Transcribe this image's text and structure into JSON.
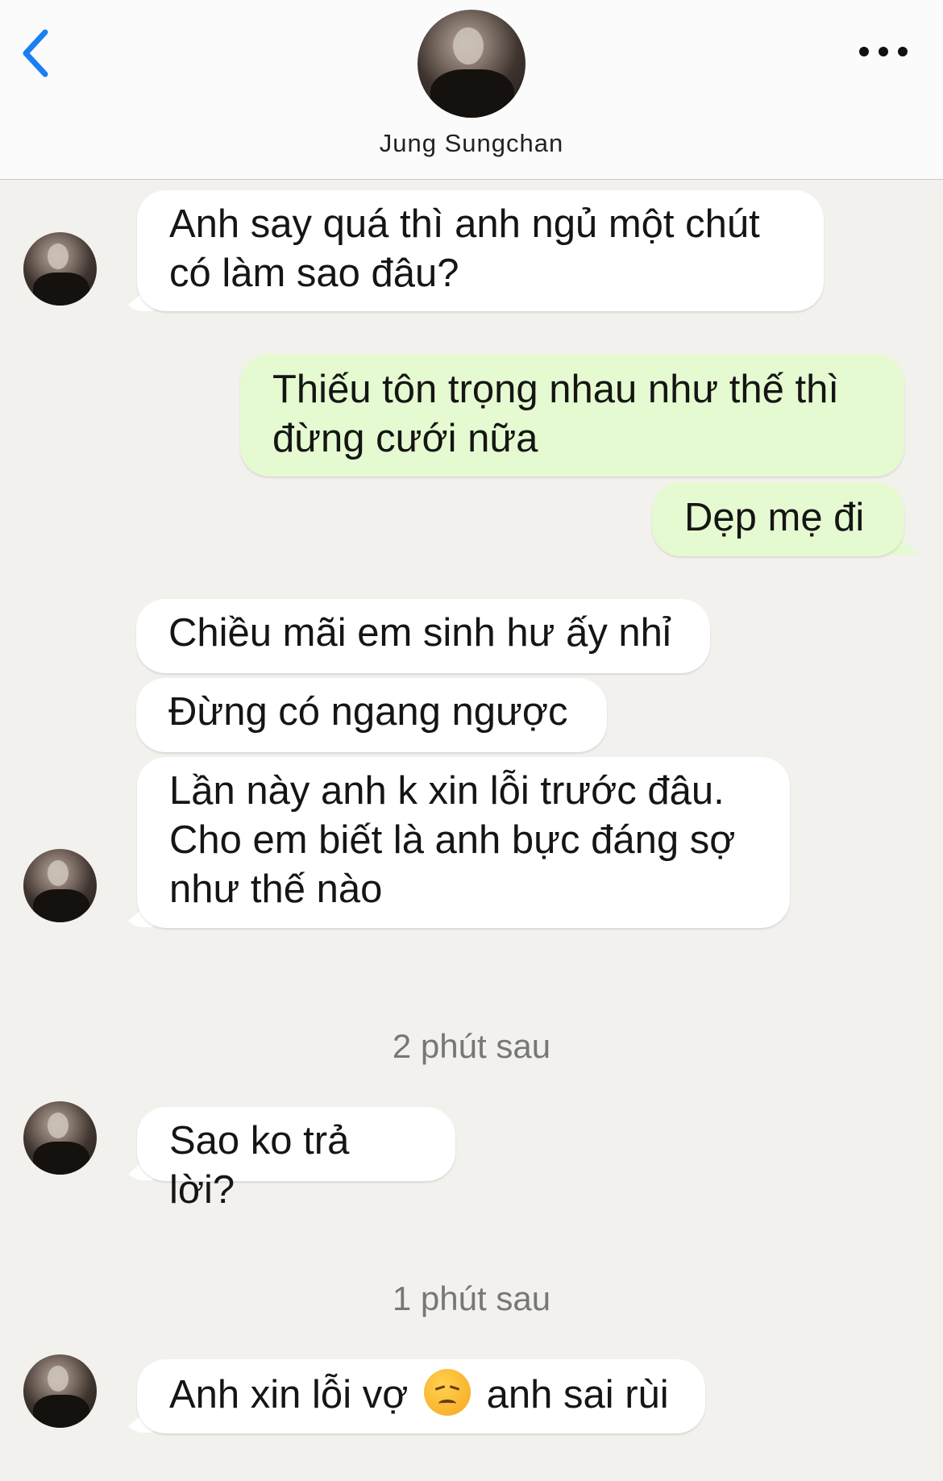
{
  "header": {
    "title": "Jung Sungchan",
    "back_icon": "chevron-left-icon",
    "more_icon": "ellipsis-icon",
    "accent_color": "#1a7ff5"
  },
  "messages": [
    {
      "from": "contact",
      "text_lines": [
        "Anh say quá thì anh ngủ một chút",
        "có làm sao đâu?"
      ]
    },
    {
      "from": "me",
      "text_lines": [
        "Thiếu tôn trọng nhau như thế thì",
        "đừng cưới nữa"
      ]
    },
    {
      "from": "me",
      "text_lines": [
        "Dẹp mẹ đi"
      ]
    },
    {
      "from": "contact",
      "text_lines": [
        "Chiều mãi em sinh hư ấy nhỉ"
      ]
    },
    {
      "from": "contact",
      "text_lines": [
        "Đừng có ngang ngược"
      ]
    },
    {
      "from": "contact",
      "text_lines": [
        "Lần này anh k xin lỗi trước đâu.",
        "Cho em biết là anh bực đáng sợ",
        "như thế nào"
      ]
    },
    {
      "from": "contact",
      "text_lines": [
        "Sao ko trả lời?"
      ]
    },
    {
      "from": "contact",
      "text_before_emoji": "Anh xin lỗi vợ",
      "emoji": "disappointed-face-emoji",
      "text_after_emoji": "anh sai rùi"
    }
  ],
  "timestamps": [
    "2 phút sau",
    "1 phút sau"
  ]
}
